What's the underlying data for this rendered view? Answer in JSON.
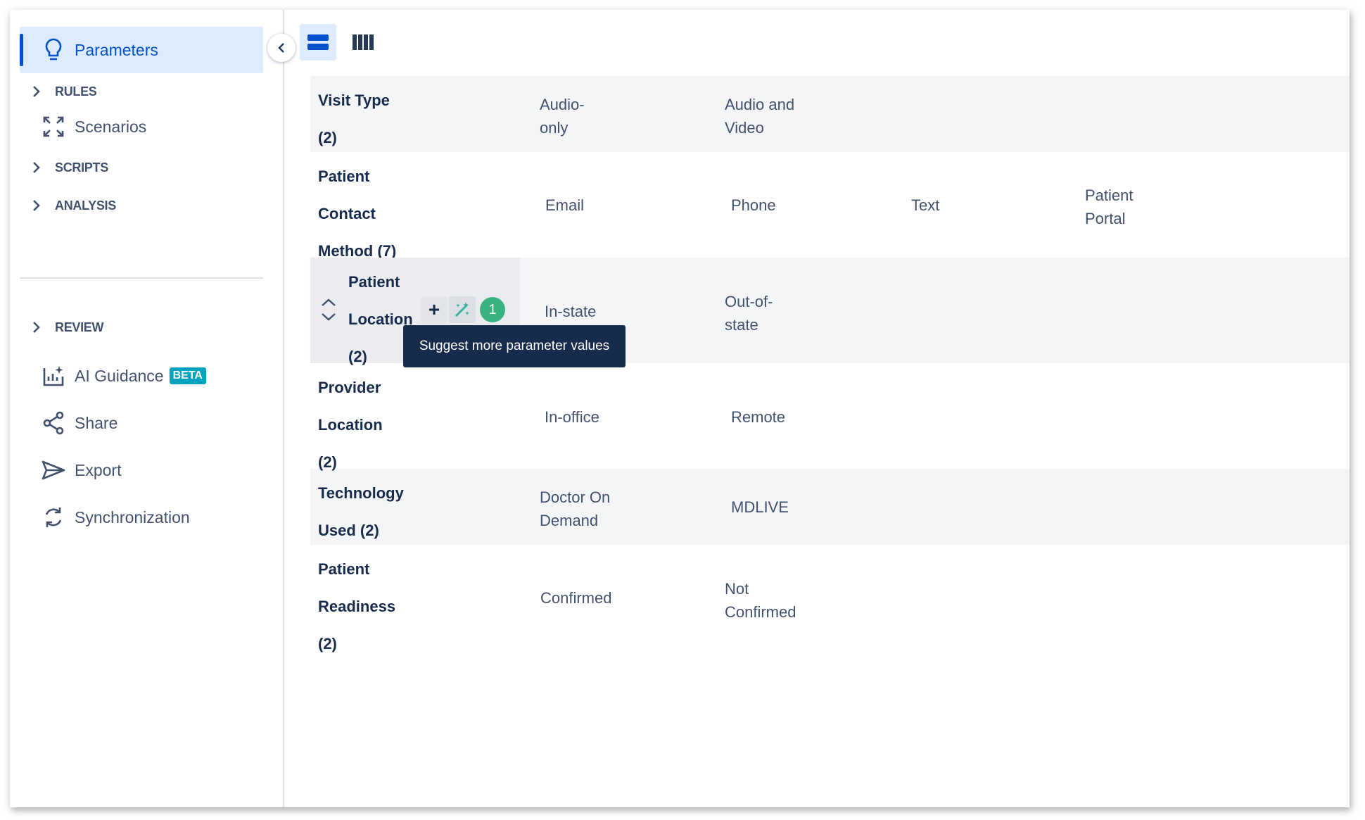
{
  "sidebar": {
    "active": {
      "label": "Parameters",
      "icon": "lightbulb-icon"
    },
    "sections": [
      {
        "label": "RULES"
      },
      {
        "label": "SCRIPTS"
      },
      {
        "label": "ANALYSIS"
      },
      {
        "label": "REVIEW"
      }
    ],
    "items": {
      "scenarios": "Scenarios",
      "ai_guidance": "AI Guidance",
      "beta": "BETA",
      "share": "Share",
      "export": "Export",
      "synchronization": "Synchronization"
    }
  },
  "toolbar": {
    "view_list": "list-view-icon",
    "view_grid": "grid-view-icon"
  },
  "parameters": [
    {
      "name_lines": [
        "Visit Type",
        "(2)"
      ],
      "values": [
        [
          "Audio-",
          "only"
        ],
        [
          "Audio and",
          "Video"
        ]
      ]
    },
    {
      "name_lines": [
        "Patient",
        "Contact",
        "Method (7)"
      ],
      "values": [
        [
          "Email"
        ],
        [
          "Phone"
        ],
        [
          "Text"
        ],
        [
          "Patient",
          "Portal"
        ]
      ]
    },
    {
      "name_lines": [
        "Patient",
        "Location",
        "(2)"
      ],
      "values": [
        [
          "In-state"
        ],
        [
          "Out-of-",
          "state"
        ]
      ]
    },
    {
      "name_lines": [
        "Provider",
        "Location",
        "(2)"
      ],
      "values": [
        [
          "In-office"
        ],
        [
          "Remote"
        ]
      ]
    },
    {
      "name_lines": [
        "Technology",
        "Used (2)"
      ],
      "values": [
        [
          "Doctor On",
          "Demand"
        ],
        [
          "MDLIVE"
        ]
      ]
    },
    {
      "name_lines": [
        "Patient",
        "Readiness",
        "(2)"
      ],
      "values": [
        [
          "Confirmed"
        ],
        [
          "Not",
          "Confirmed"
        ]
      ]
    }
  ],
  "hover_actions": {
    "add": "+",
    "suggest_badge": "1"
  },
  "tooltip": "Suggest more parameter values",
  "colors": {
    "accent": "#0052cc",
    "active_bg": "#deebff",
    "badge": "#36b37e",
    "beta": "#00a3bf",
    "tooltip_bg": "#172b4d"
  }
}
